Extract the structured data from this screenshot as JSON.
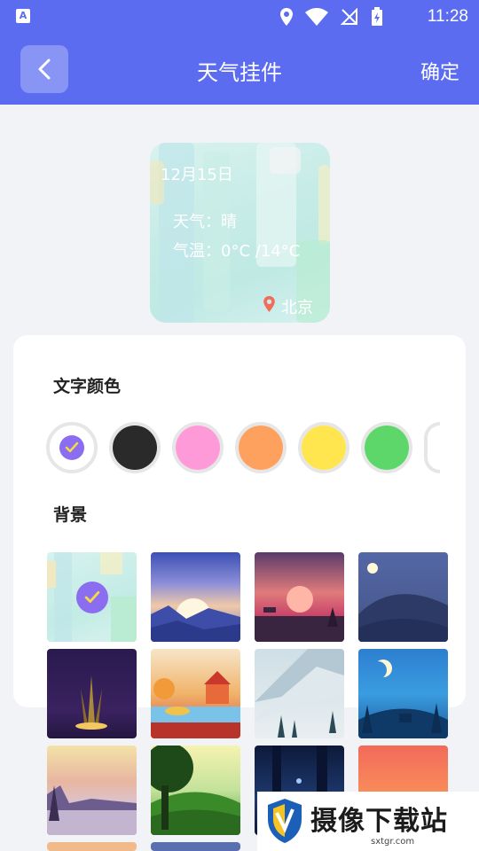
{
  "status_bar": {
    "time": "11:28",
    "left_icon_letter": "A"
  },
  "app_bar": {
    "title": "天气挂件",
    "confirm_label": "确定"
  },
  "preview": {
    "date": "12月15日",
    "weather_line": "天气：晴",
    "temperature_line": "气温：0°C /14°C",
    "city": "北京"
  },
  "text_color_section": {
    "title": "文字颜色",
    "swatches": [
      {
        "color": "#ffffff",
        "selected": true
      },
      {
        "color": "#2a2a2a"
      },
      {
        "color": "#ff9ad8"
      },
      {
        "color": "#ffa15e"
      },
      {
        "color": "#ffe64f"
      },
      {
        "color": "#5ed76a"
      }
    ]
  },
  "background_section": {
    "title": "背景"
  },
  "watermark": {
    "name": "摄像下载站",
    "url": "sxtgr.com"
  }
}
